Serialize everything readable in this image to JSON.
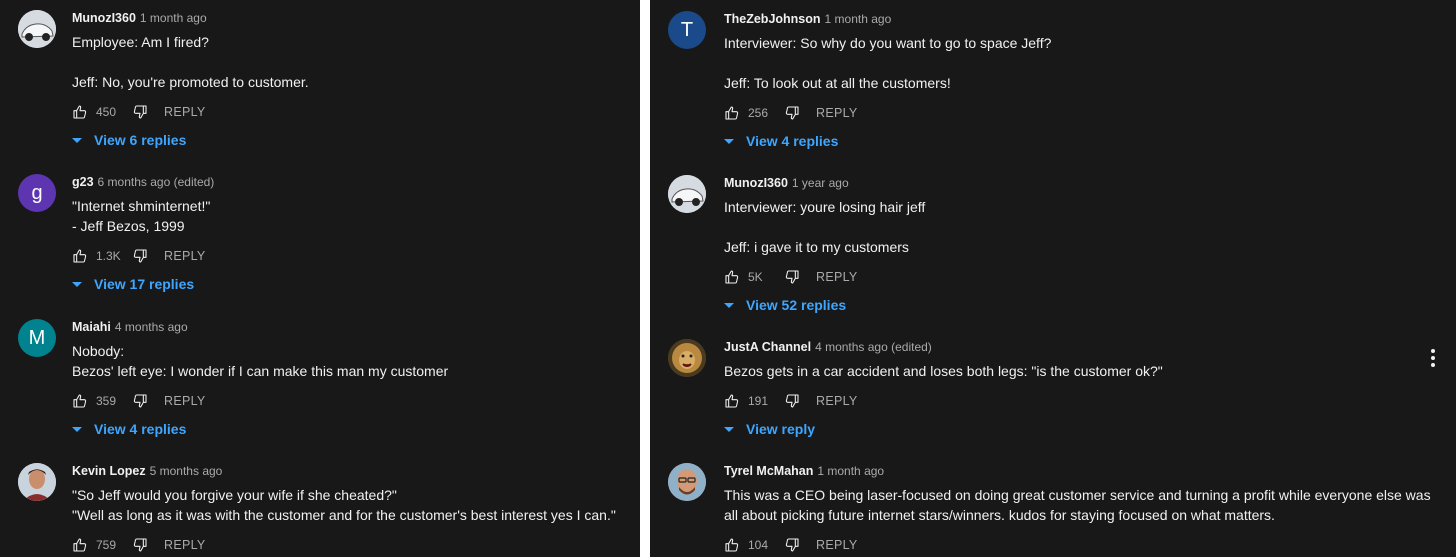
{
  "left": {
    "comments": [
      {
        "author": "MunozI360",
        "time": "1 month ago",
        "text": "Employee: Am I fired?\n\nJeff: No, you're promoted to customer.",
        "likes": "450",
        "reply_label": "REPLY",
        "replies_label": "View 6 replies",
        "avatar_icon": "car-avatar-icon"
      },
      {
        "author": "g23",
        "time": "6 months ago (edited)",
        "text": "\"Internet shminternet!\"\n- Jeff Bezos, 1999",
        "likes": "1.3K",
        "reply_label": "REPLY",
        "replies_label": "View 17 replies",
        "avatar_letter": "g",
        "avatar_color": "#5e35b1"
      },
      {
        "author": "Maiahi",
        "time": "4 months ago",
        "text": "Nobody:\nBezos' left eye: I wonder if I can make this man my customer",
        "likes": "359",
        "reply_label": "REPLY",
        "replies_label": "View 4 replies",
        "avatar_letter": "M",
        "avatar_color": "#00838f"
      },
      {
        "author": "Kevin Lopez",
        "time": "5 months ago",
        "text": "\"So Jeff would you forgive your wife if she cheated?\"\n\"Well as long as it was with the customer and for the customer's best interest yes I can.\"",
        "likes": "759",
        "reply_label": "REPLY",
        "avatar_icon": "person-avatar-icon"
      }
    ]
  },
  "right": {
    "comments": [
      {
        "author": "TheZebJohnson",
        "time": "1 month ago",
        "text": "Interviewer: So why do you want to go to space Jeff?\n\nJeff: To look out at all the customers!",
        "likes": "256",
        "reply_label": "REPLY",
        "replies_label": "View 4 replies",
        "avatar_letter": "T",
        "avatar_color": "#1a4a8a"
      },
      {
        "author": "MunozI360",
        "time": "1 year ago",
        "text": "Interviewer: youre losing hair jeff\n\nJeff: i gave it to my customers",
        "likes": "5K",
        "reply_label": "REPLY",
        "replies_label": "View 52 replies",
        "avatar_icon": "car-avatar-icon"
      },
      {
        "author": "JustA Channel",
        "time": "4 months ago (edited)",
        "text": "Bezos gets in a car accident and loses both legs: \"is the customer ok?\"",
        "likes": "191",
        "reply_label": "REPLY",
        "replies_label": "View reply",
        "avatar_icon": "lion-avatar-icon",
        "menu_icon": "kebab-menu-icon"
      },
      {
        "author": "Tyrel McMahan",
        "time": "1 month ago",
        "text": "This was a CEO being laser-focused on doing great customer service and turning a profit while everyone else was all about picking future internet stars/winners. kudos for staying focused on what matters.",
        "likes": "104",
        "reply_label": "REPLY",
        "avatar_icon": "person-avatar-icon"
      }
    ]
  },
  "colors": {
    "background": "#181818",
    "link": "#3ea6ff",
    "text": "#f1f1f1",
    "muted": "#aaaaaa"
  }
}
